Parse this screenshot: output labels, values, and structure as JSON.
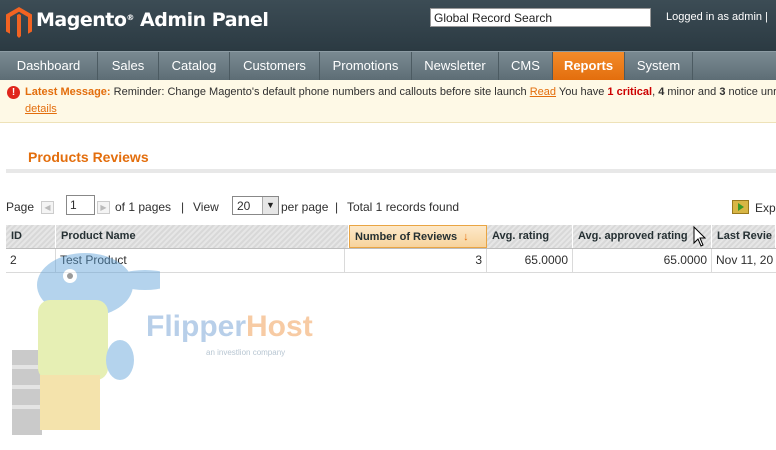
{
  "header": {
    "logo_text": "Magento",
    "logo_sub": "Admin Panel",
    "search_value": "Global Record Search",
    "logged_in": "Logged in as admin  |"
  },
  "nav": [
    {
      "label": "Dashboard"
    },
    {
      "label": "Sales"
    },
    {
      "label": "Catalog"
    },
    {
      "label": "Customers"
    },
    {
      "label": "Promotions"
    },
    {
      "label": "Newsletter"
    },
    {
      "label": "CMS"
    },
    {
      "label": "Reports",
      "active": true
    },
    {
      "label": "System"
    }
  ],
  "message": {
    "label": "Latest Message:",
    "text": " Reminder: Change Magento's default phone numbers and callouts before site launch ",
    "read_link": "Read",
    "you_have": " You have ",
    "critical_count": "1 critical",
    "minor_count": "4",
    "minor_text": " minor and ",
    "notice_count": "3",
    "notice_text": " notice unrea",
    "details_link": "details"
  },
  "page": {
    "title": "Products Reviews"
  },
  "pager": {
    "page_label": "Page",
    "page_value": "1",
    "of_pages": "of 1 pages",
    "sep1": "|",
    "view_label": "View",
    "per_page_value": "20",
    "per_page_label": "per page",
    "sep2": "|",
    "total": "Total 1 records found",
    "export_label": "Expo"
  },
  "grid": {
    "columns": [
      "ID",
      "Product Name",
      "Number of Reviews",
      "Avg. rating",
      "Avg. approved rating",
      "Last Revie"
    ],
    "rows": [
      {
        "id": "2",
        "name": "Test Product",
        "reviews": "3",
        "avg": "65.0000",
        "avg_approved": "65.0000",
        "last": "Nov 11, 20"
      }
    ]
  },
  "watermark": {
    "flipper": "Flipper",
    "host": "Host",
    "sub": "an investlion company"
  },
  "colors": {
    "accent": "#e36e0d",
    "header_bg": "#2b3a42",
    "nav_bg": "#5d6d75",
    "message_bg": "#fef9e6"
  }
}
